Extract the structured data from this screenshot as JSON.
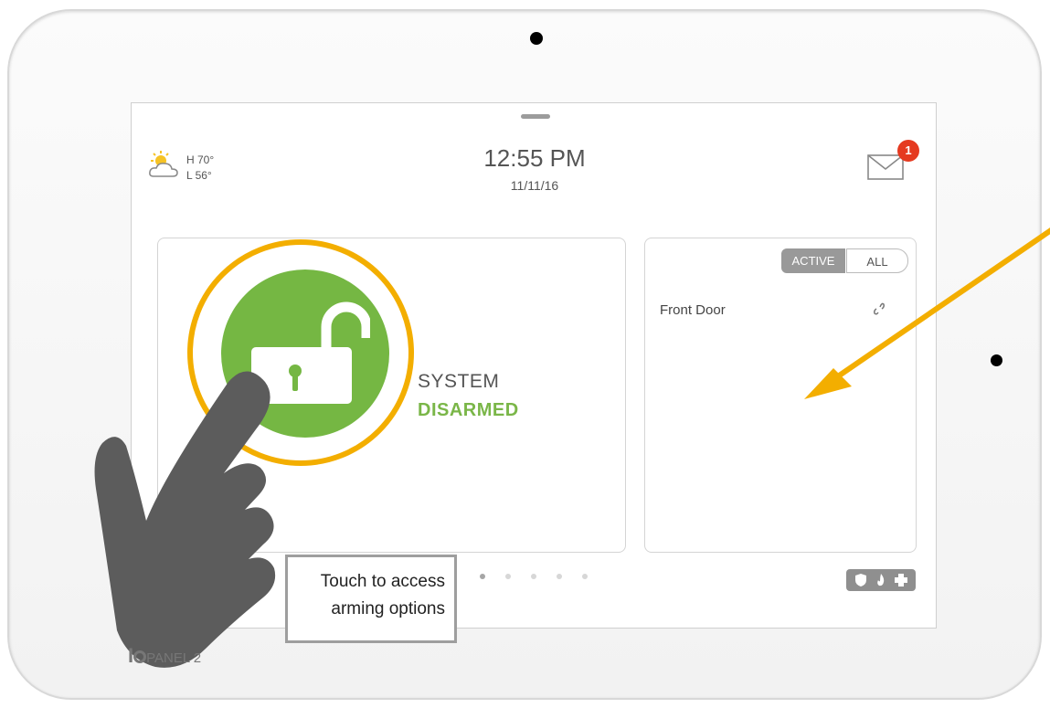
{
  "weather": {
    "high": "H 70°",
    "low": "L 56°",
    "icon": "partly-cloudy-icon"
  },
  "clock": {
    "time": "12:55 PM",
    "date": "11/11/16"
  },
  "messages": {
    "count": "1",
    "icon": "mail-icon"
  },
  "status": {
    "line1": "SYSTEM",
    "line2": "DISARMED",
    "icon": "unlock-icon"
  },
  "sensors": {
    "filters": {
      "active": "ACTIVE",
      "all": "ALL"
    },
    "items": [
      {
        "name": "Front Door",
        "icon": "open-link-icon"
      }
    ]
  },
  "pager": {
    "count": 6,
    "current": 0
  },
  "emergency": {
    "icons": [
      "shield-icon",
      "fire-icon",
      "plus-icon"
    ]
  },
  "callout": {
    "line1": "Touch to access",
    "line2": "arming options"
  },
  "brand": {
    "logo_text": "PANEL 2"
  },
  "colors": {
    "accent_ring": "#f3ae00",
    "disarmed_green": "#7ab648",
    "badge_red": "#e53a20",
    "arrow": "#f3ae00"
  }
}
